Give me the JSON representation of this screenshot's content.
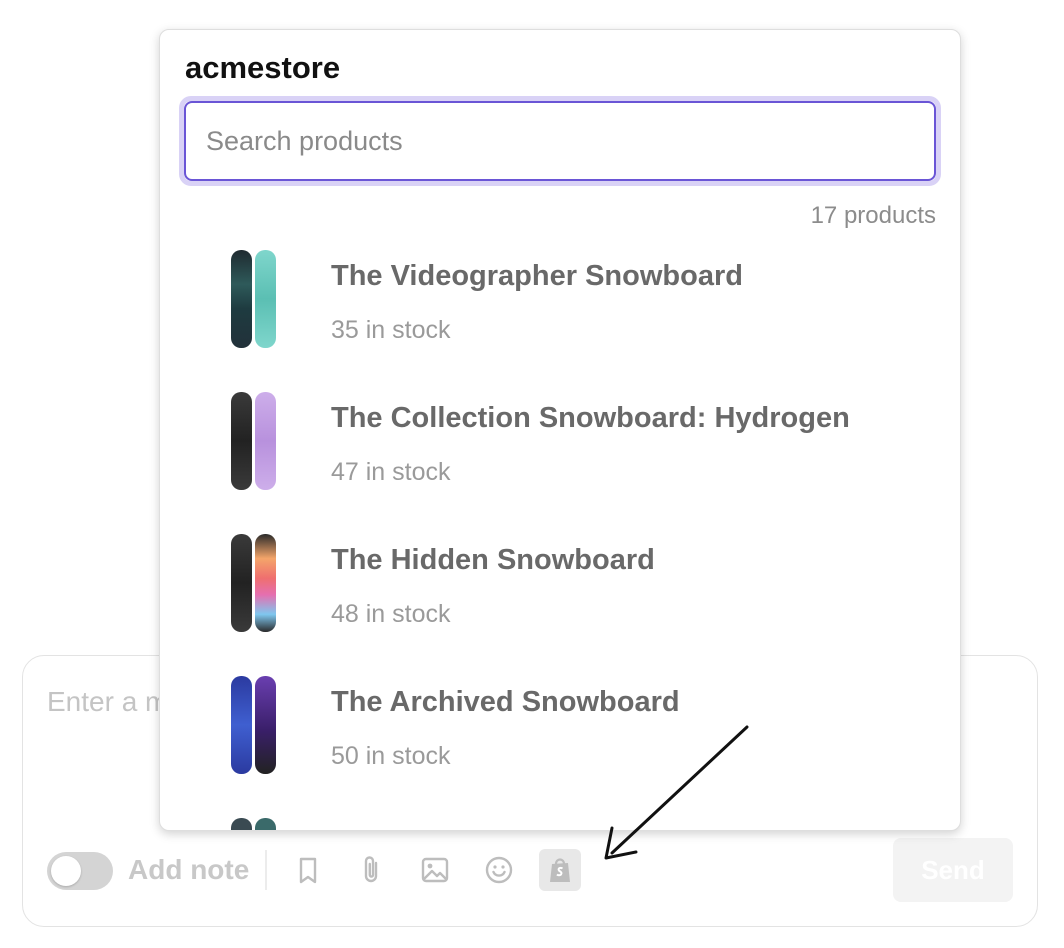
{
  "composer": {
    "placeholder": "Enter a message",
    "note_label": "Add note",
    "send_label": "Send",
    "note_toggle_on": false,
    "toolbar_icons": [
      "bookmark-icon",
      "paperclip-icon",
      "image-icon",
      "smiley-icon",
      "shopify-bag-icon"
    ],
    "active_icon": "shopify-bag-icon"
  },
  "popover": {
    "store_name": "acmestore",
    "search_placeholder": "Search products",
    "product_count": "17 products",
    "products": [
      {
        "title": "The Videographer Snowboard",
        "stock": "35 in stock",
        "colors": [
          "#22313a",
          "#6cc7bd"
        ]
      },
      {
        "title": "The Collection Snowboard: Hydrogen",
        "stock": "47 in stock",
        "colors": [
          "#2b2b2b",
          "#c6a2e3"
        ]
      },
      {
        "title": "The Hidden Snowboard",
        "stock": "48 in stock",
        "colors": [
          "#2b2b2b",
          "#f0846a"
        ]
      },
      {
        "title": "The Archived Snowboard",
        "stock": "50 in stock",
        "colors": [
          "#2c3fa8",
          "#4a2c7a"
        ]
      },
      {
        "title": "",
        "stock": "",
        "colors": [
          "#3a4a52",
          "#3a6a6a"
        ]
      }
    ]
  },
  "colors": {
    "accent": "#6a55d6",
    "focus_ring": "#d9d2f6"
  }
}
